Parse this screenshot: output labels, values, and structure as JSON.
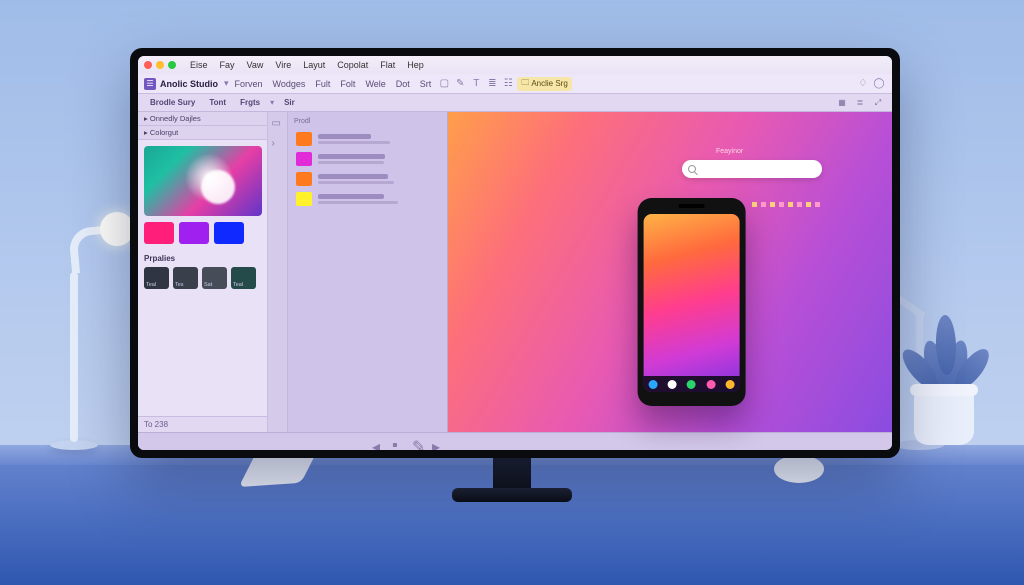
{
  "os_menu": [
    "Eise",
    "Fay",
    "Vaw",
    "Vire",
    "Layut",
    "Copolat",
    "Flat",
    "Hep"
  ],
  "app": {
    "title": "Anolic Studio",
    "menu": [
      "Forven",
      "Wodges",
      "Fult",
      "Folt",
      "Wele",
      "Dot",
      "Srt"
    ],
    "chip": "Anclie Srg"
  },
  "toolbar": {
    "tabs": [
      "Brodle Sury",
      "Tont",
      "Frgts",
      "Sir"
    ]
  },
  "sidebar": {
    "section1": "Onnedly Dajles",
    "section2": "Colorgut",
    "swatches1": [
      "#ff1f7a",
      "#a020f0",
      "#1029ff"
    ],
    "properties_label": "Prpalies",
    "palette": [
      {
        "c": "#2f3542",
        "t": "Teal"
      },
      {
        "c": "#3a3f4c",
        "t": "Tes"
      },
      {
        "c": "#474c59",
        "t": "Sat"
      },
      {
        "c": "#244a4a",
        "t": "Teal"
      }
    ],
    "status": "To 238"
  },
  "layers": {
    "header": "Prodl",
    "items": [
      {
        "color": "#ff7a1f"
      },
      {
        "color": "#e22bd8"
      },
      {
        "color": "#ff7a1f"
      },
      {
        "color": "#fff22b"
      }
    ]
  },
  "canvas": {
    "search_label": "Feayinor",
    "search_placeholder": ""
  },
  "phone": {
    "nav_colors": [
      "#2aa8ff",
      "#ffffff",
      "#2bd46a",
      "#ff5bb0",
      "#ffb82b"
    ]
  }
}
